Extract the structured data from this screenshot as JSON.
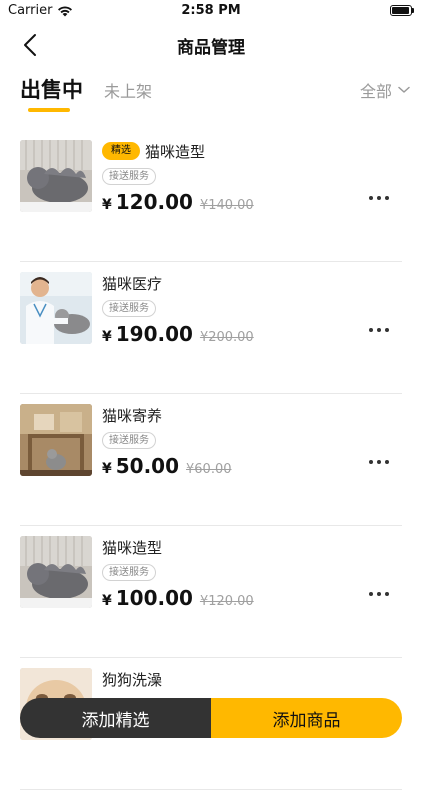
{
  "status_bar": {
    "carrier": "Carrier",
    "time": "2:58 PM"
  },
  "header": {
    "title": "商品管理"
  },
  "tabs": {
    "active": "出售中",
    "inactive": "未上架",
    "filter": "全部"
  },
  "products": [
    {
      "badge": "精选",
      "name": "猫咪造型",
      "tag": "接送服务",
      "currency": "¥",
      "price": "120.00",
      "original_price": "¥140.00"
    },
    {
      "badge": "",
      "name": "猫咪医疗",
      "tag": "接送服务",
      "currency": "¥",
      "price": "190.00",
      "original_price": "¥200.00"
    },
    {
      "badge": "",
      "name": "猫咪寄养",
      "tag": "接送服务",
      "currency": "¥",
      "price": "50.00",
      "original_price": "¥60.00"
    },
    {
      "badge": "",
      "name": "猫咪造型",
      "tag": "接送服务",
      "currency": "¥",
      "price": "100.00",
      "original_price": "¥120.00"
    },
    {
      "badge": "",
      "name": "狗狗洗澡",
      "tag": "",
      "currency": "",
      "price": "",
      "original_price": ""
    }
  ],
  "bottom_bar": {
    "featured_label": "添加精选",
    "add_label": "添加商品"
  },
  "colors": {
    "accent": "#FFB800",
    "dark_button": "#333333"
  }
}
